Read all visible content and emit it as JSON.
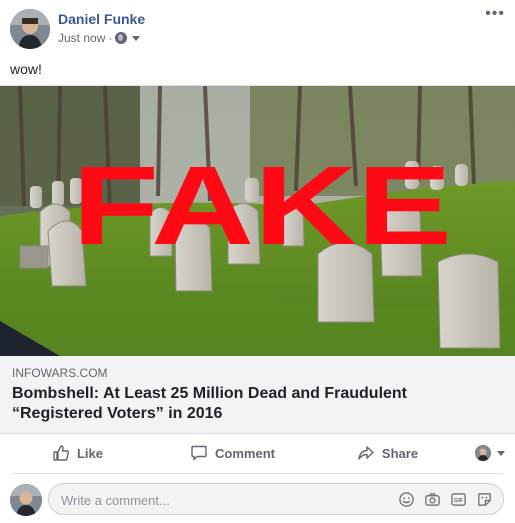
{
  "post": {
    "author": "Daniel Funke",
    "timestamp": "Just now",
    "separator": "·",
    "text": "wow!",
    "more_label": "•••"
  },
  "preview": {
    "stamp": "FAKE",
    "domain": "INFOWARS.COM",
    "headline": "Bombshell: At Least 25 Million Dead and Fraudulent “Registered Voters” in 2016"
  },
  "actions": {
    "like": "Like",
    "comment": "Comment",
    "share": "Share"
  },
  "comment": {
    "placeholder": "Write a comment..."
  },
  "colors": {
    "author_link": "#385898",
    "stamp_red": "#ff0a14",
    "muted": "#606770"
  },
  "icons": [
    "globe-icon",
    "caret-down-icon",
    "more-icon",
    "like-icon",
    "comment-icon",
    "share-icon",
    "emoji-icon",
    "camera-icon",
    "gif-icon",
    "sticker-icon"
  ]
}
